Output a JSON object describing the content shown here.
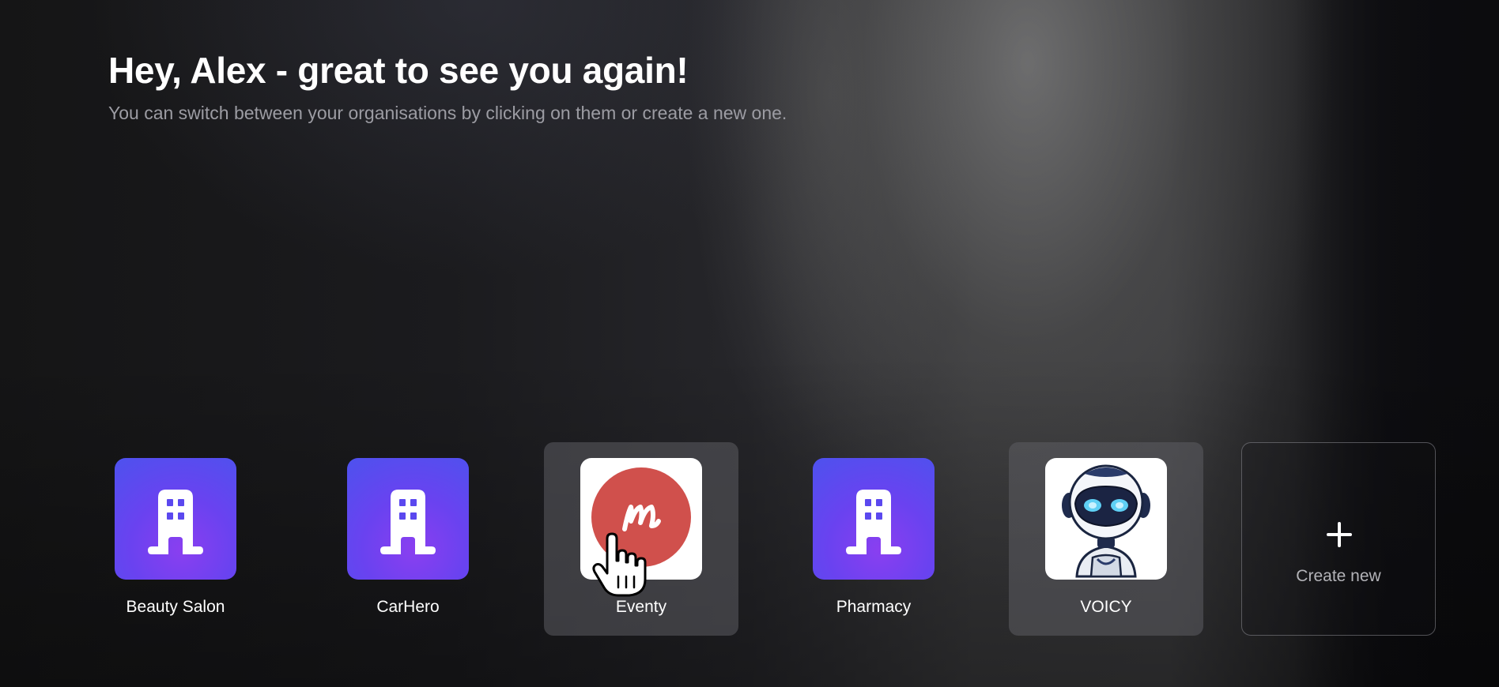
{
  "header": {
    "title": "Hey, Alex - great to see you again!",
    "subtitle": "You can switch between your organisations by clicking on them or create a new one."
  },
  "organisations": [
    {
      "name": "Beauty Salon",
      "icon": "building-icon",
      "selected": false
    },
    {
      "name": "CarHero",
      "icon": "building-icon",
      "selected": false
    },
    {
      "name": "Eventy",
      "icon": "eventy-logo",
      "selected": true
    },
    {
      "name": "Pharmacy",
      "icon": "building-icon",
      "selected": false
    },
    {
      "name": "VOICY",
      "icon": "robot-logo",
      "selected": false
    }
  ],
  "create": {
    "label": "Create new",
    "icon": "plus-icon"
  },
  "colors": {
    "building_gradient_start": "#8a3ff0",
    "building_gradient_end": "#4d52ee",
    "eventy_red": "#d0504c",
    "subtitle": "#9c9ca3"
  }
}
